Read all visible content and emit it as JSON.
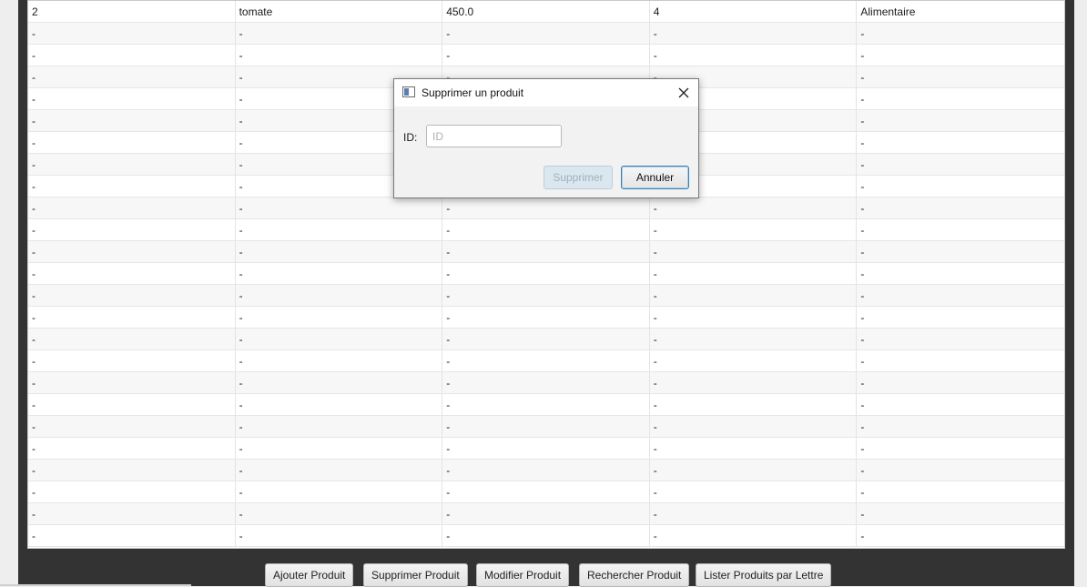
{
  "table": {
    "rows": [
      [
        "2",
        "tomate",
        "450.0",
        "4",
        "Alimentaire"
      ],
      [
        "-",
        "-",
        "-",
        "-",
        "-"
      ],
      [
        "-",
        "-",
        "-",
        "-",
        "-"
      ],
      [
        "-",
        "-",
        "-",
        "-",
        "-"
      ],
      [
        "-",
        "-",
        "-",
        "-",
        "-"
      ],
      [
        "-",
        "-",
        "-",
        "-",
        "-"
      ],
      [
        "-",
        "-",
        "-",
        "-",
        "-"
      ],
      [
        "-",
        "-",
        "-",
        "-",
        "-"
      ],
      [
        "-",
        "-",
        "-",
        "-",
        "-"
      ],
      [
        "-",
        "-",
        "-",
        "-",
        "-"
      ],
      [
        "-",
        "-",
        "-",
        "-",
        "-"
      ],
      [
        "-",
        "-",
        "-",
        "-",
        "-"
      ],
      [
        "-",
        "-",
        "-",
        "-",
        "-"
      ],
      [
        "-",
        "-",
        "-",
        "-",
        "-"
      ],
      [
        "-",
        "-",
        "-",
        "-",
        "-"
      ],
      [
        "-",
        "-",
        "-",
        "-",
        "-"
      ],
      [
        "-",
        "-",
        "-",
        "-",
        "-"
      ],
      [
        "-",
        "-",
        "-",
        "-",
        "-"
      ],
      [
        "-",
        "-",
        "-",
        "-",
        "-"
      ],
      [
        "-",
        "-",
        "-",
        "-",
        "-"
      ],
      [
        "-",
        "-",
        "-",
        "-",
        "-"
      ],
      [
        "-",
        "-",
        "-",
        "-",
        "-"
      ],
      [
        "-",
        "-",
        "-",
        "-",
        "-"
      ],
      [
        "-",
        "-",
        "-",
        "-",
        "-"
      ],
      [
        "-",
        "-",
        "-",
        "-",
        "-"
      ]
    ]
  },
  "toolbar": {
    "add_label": "Ajouter Produit",
    "delete_label": "Supprimer Produit",
    "edit_label": "Modifier Produit",
    "search_label": "Rechercher Produit",
    "list_label": "Lister Produits par Lettre"
  },
  "dialog": {
    "title": "Supprimer un produit",
    "id_label": "ID:",
    "id_value": "",
    "id_placeholder": "ID",
    "confirm_label": "Supprimer",
    "cancel_label": "Annuler",
    "icons": {
      "app": "window-app-icon",
      "close": "close-icon"
    }
  },
  "colors": {
    "frame": "#333333",
    "row_alt": "#f7f7f7",
    "disabled_button": "#dbe7ef",
    "focus_border": "#3c7fb1"
  }
}
